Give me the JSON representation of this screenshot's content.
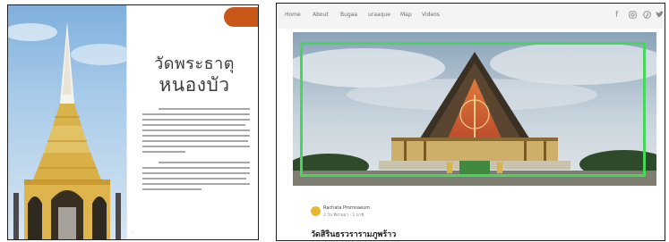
{
  "magazine": {
    "title_line1": "วัดพระธาตุ",
    "title_line2": "หนองบัว"
  },
  "website": {
    "nav": [
      "Home",
      "About",
      "Bugaa",
      "uraaque",
      "Map",
      "Videos"
    ],
    "social_icons": [
      "facebook-icon",
      "instagram-icon",
      "pinterest-icon",
      "twitter-icon"
    ],
    "author": "Rachata Promnaeum",
    "post_meta": "2 วัน ที่ผ่านมา · 1 นาที",
    "post_title": "วัดสิรินธรวรารามภูพร้าว"
  },
  "colors": {
    "orange_tab": "#c9571a",
    "highlight_frame": "#46d65b",
    "avatar": "#e8b82c",
    "nav_bar": "#f4f4f4"
  }
}
